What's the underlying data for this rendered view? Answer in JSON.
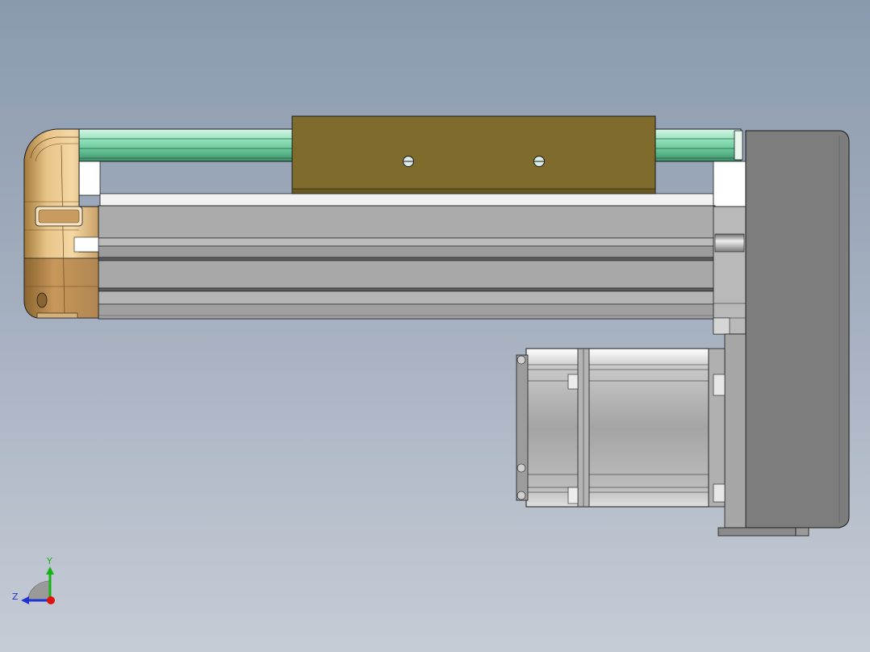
{
  "triad": {
    "y_label": "Y",
    "z_label": "Z",
    "y_color": "#14b414",
    "z_color": "#1e32d2",
    "x_color": "#e01010"
  },
  "colors": {
    "rail": "#8fe0b8",
    "carriage": "#7f6c2c",
    "end_cap": "#d9b070",
    "housing": "#a9a9a9",
    "motor": "#a8a8a8",
    "gearbox": "#7d7d7d"
  }
}
